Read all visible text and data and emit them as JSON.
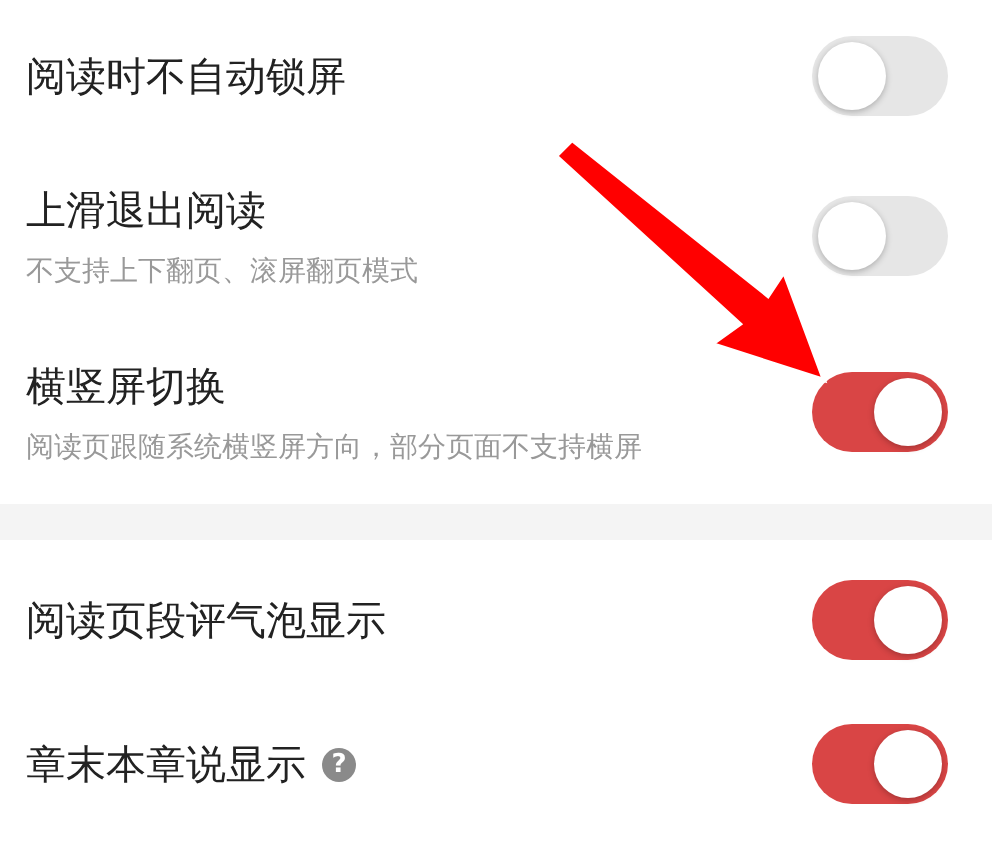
{
  "sections": [
    {
      "items": [
        {
          "title": "阅读时不自动锁屏",
          "on": false
        },
        {
          "title": "上滑退出阅读",
          "subtitle": "不支持上下翻页、滚屏翻页模式",
          "on": false
        },
        {
          "title": "横竖屏切换",
          "subtitle": "阅读页跟随系统横竖屏方向，部分页面不支持横屏",
          "on": true
        }
      ]
    },
    {
      "items": [
        {
          "title": "阅读页段评气泡显示",
          "on": true
        },
        {
          "title": "章末本章说显示",
          "help": "?",
          "on": true
        }
      ]
    }
  ]
}
